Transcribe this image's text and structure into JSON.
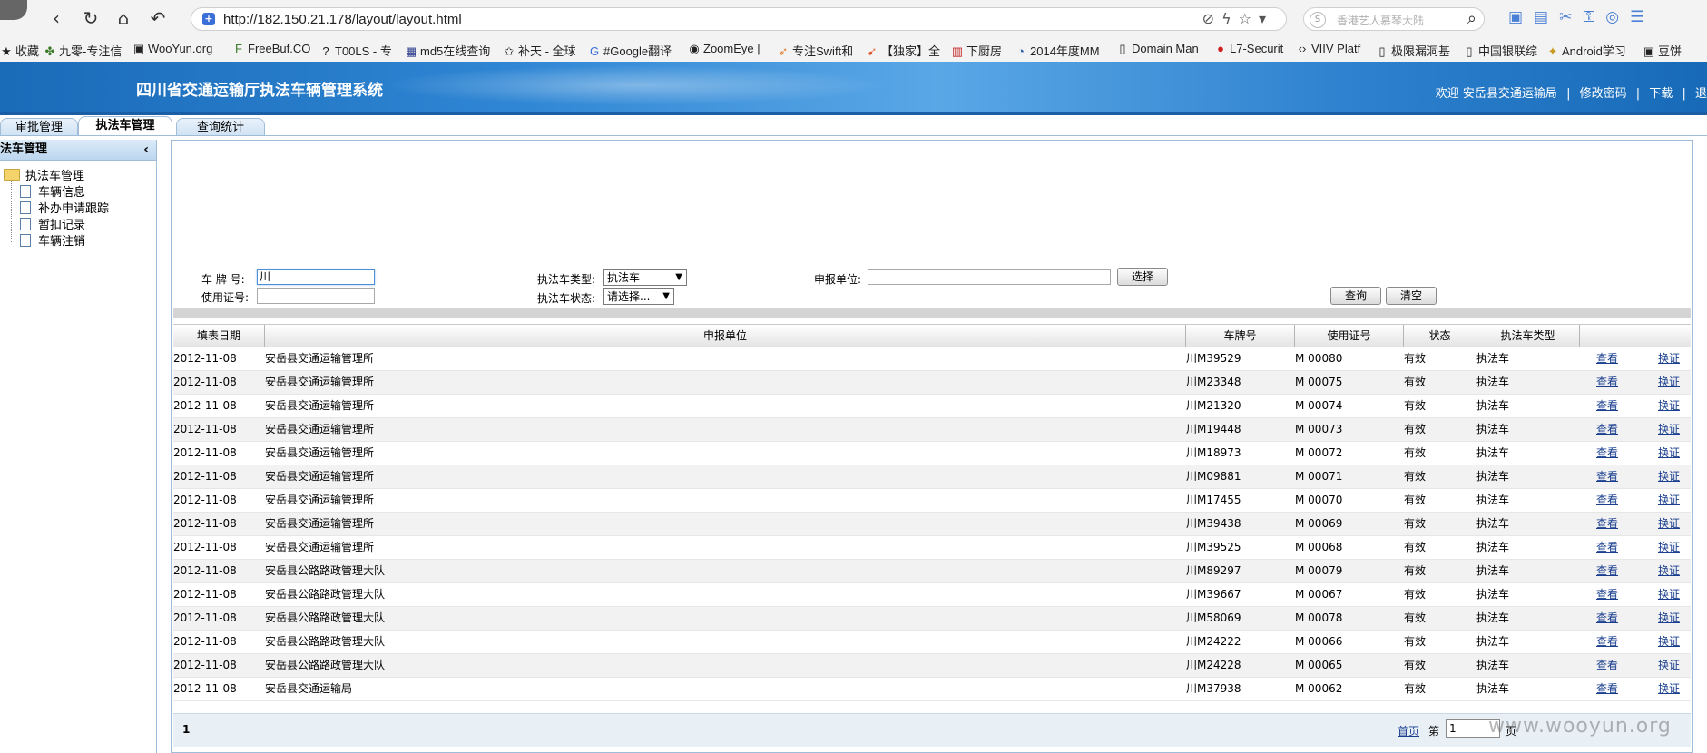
{
  "browser": {
    "url": "http://182.150.21.178/layout/layout.html",
    "search_placeholder": "香港艺人慕琴大陆",
    "bookmarks": [
      {
        "label": "收藏",
        "icon": "star-icon"
      },
      {
        "label": "九零-专注信",
        "icon": "leaf-icon"
      },
      {
        "label": "WooYun.org",
        "icon": "wooyun-icon"
      },
      {
        "label": "FreeBuf.CO",
        "icon": "freebuf-icon"
      },
      {
        "label": "T00LS - 专",
        "icon": "tools-icon"
      },
      {
        "label": "md5在线查询",
        "icon": "grid-icon"
      },
      {
        "label": "补天 - 全球",
        "icon": "butian-icon"
      },
      {
        "label": "#Google翻译",
        "icon": "translate-icon"
      },
      {
        "label": "ZoomEye |",
        "icon": "eye-icon"
      },
      {
        "label": "专注Swift和",
        "icon": "swift-icon"
      },
      {
        "label": "【独家】全",
        "icon": "bird-icon"
      },
      {
        "label": "下厨房",
        "icon": "kitchen-icon"
      },
      {
        "label": "2014年度MM",
        "icon": "play-icon"
      },
      {
        "label": "Domain Man",
        "icon": "page-icon"
      },
      {
        "label": "L7-Securit",
        "icon": "l7-icon"
      },
      {
        "label": "VIIV Platf",
        "icon": "code-icon"
      },
      {
        "label": "极限漏洞基",
        "icon": "page-icon"
      },
      {
        "label": "中国银联综",
        "icon": "page-icon"
      },
      {
        "label": "Android学习",
        "icon": "android-icon"
      },
      {
        "label": "豆饼",
        "icon": "bean-icon"
      }
    ]
  },
  "header": {
    "title": "四川省交通运输厅执法车辆管理系统",
    "welcome": "欢迎 安岳县交通运输局",
    "separator": "|",
    "change_password": "修改密码",
    "download": "下载",
    "logout": "退"
  },
  "tabs": [
    {
      "label": "审批管理",
      "active": false
    },
    {
      "label": "执法车管理",
      "active": true
    },
    {
      "label": "查询统计",
      "active": false
    }
  ],
  "sidebar": {
    "title": "法车管理",
    "root": "执法车管理",
    "items": [
      "车辆信息",
      "补办申请跟踪",
      "暂扣记录",
      "车辆注销"
    ]
  },
  "form": {
    "plate_label": "车 牌 号:",
    "plate_value": "川",
    "cert_label": "使用证号:",
    "cert_value": "",
    "type_label": "执法车类型:",
    "type_value": "执法车",
    "status_label": "执法车状态:",
    "status_value": "请选择...",
    "unit_label": "申报单位:",
    "unit_value": "",
    "select_button": "选择",
    "query_button": "查询",
    "clear_button": "清空"
  },
  "table": {
    "columns": [
      "填表日期",
      "申报单位",
      "车牌号",
      "使用证号",
      "状态",
      "执法车类型",
      "",
      ""
    ],
    "view_label": "查看",
    "replace_label": "换证",
    "rows": [
      [
        "2012-11-08",
        "安岳县交通运输管理所",
        "川M39529",
        "M 00080",
        "有效",
        "执法车"
      ],
      [
        "2012-11-08",
        "安岳县交通运输管理所",
        "川M23348",
        "M 00075",
        "有效",
        "执法车"
      ],
      [
        "2012-11-08",
        "安岳县交通运输管理所",
        "川M21320",
        "M 00074",
        "有效",
        "执法车"
      ],
      [
        "2012-11-08",
        "安岳县交通运输管理所",
        "川M19448",
        "M 00073",
        "有效",
        "执法车"
      ],
      [
        "2012-11-08",
        "安岳县交通运输管理所",
        "川M18973",
        "M 00072",
        "有效",
        "执法车"
      ],
      [
        "2012-11-08",
        "安岳县交通运输管理所",
        "川M09881",
        "M 00071",
        "有效",
        "执法车"
      ],
      [
        "2012-11-08",
        "安岳县交通运输管理所",
        "川M17455",
        "M 00070",
        "有效",
        "执法车"
      ],
      [
        "2012-11-08",
        "安岳县交通运输管理所",
        "川M39438",
        "M 00069",
        "有效",
        "执法车"
      ],
      [
        "2012-11-08",
        "安岳县交通运输管理所",
        "川M39525",
        "M 00068",
        "有效",
        "执法车"
      ],
      [
        "2012-11-08",
        "安岳县公路路政管理大队",
        "川M89297",
        "M 00079",
        "有效",
        "执法车"
      ],
      [
        "2012-11-08",
        "安岳县公路路政管理大队",
        "川M39667",
        "M 00067",
        "有效",
        "执法车"
      ],
      [
        "2012-11-08",
        "安岳县公路路政管理大队",
        "川M58069",
        "M 00078",
        "有效",
        "执法车"
      ],
      [
        "2012-11-08",
        "安岳县公路路政管理大队",
        "川M24222",
        "M 00066",
        "有效",
        "执法车"
      ],
      [
        "2012-11-08",
        "安岳县公路路政管理大队",
        "川M24228",
        "M 00065",
        "有效",
        "执法车"
      ],
      [
        "2012-11-08",
        "安岳县交通运输局",
        "川M37938",
        "M 00062",
        "有效",
        "执法车"
      ]
    ]
  },
  "pager": {
    "total": "1",
    "first": "首页",
    "di": "第",
    "page": "1",
    "ye": "页"
  },
  "watermark": "www.wooyun.org",
  "colors": {
    "header_blue": "#2f86d4",
    "link": "#1a3f8f",
    "row_alt": "#f2f2f2"
  }
}
